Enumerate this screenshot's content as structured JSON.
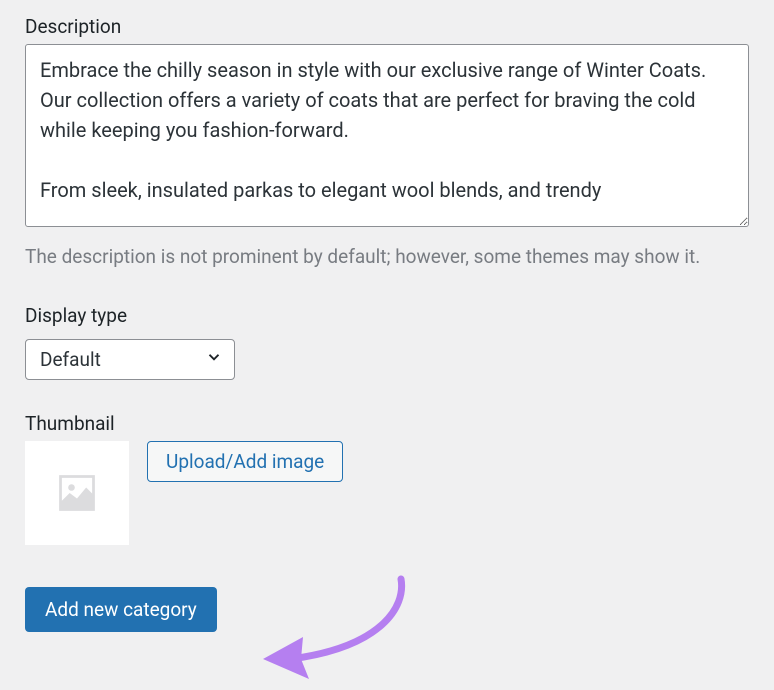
{
  "description": {
    "label": "Description",
    "value": "Embrace the chilly season in style with our exclusive range of Winter Coats. Our collection offers a variety of coats that are perfect for braving the cold while keeping you fashion-forward.\n\nFrom sleek, insulated parkas to elegant wool blends, and trendy",
    "help": "The description is not prominent by default; however, some themes may show it."
  },
  "display_type": {
    "label": "Display type",
    "selected": "Default"
  },
  "thumbnail": {
    "label": "Thumbnail",
    "upload_label": "Upload/Add image"
  },
  "submit": {
    "label": "Add new category"
  },
  "colors": {
    "primary": "#2271b1",
    "arrow": "#b57ff0"
  }
}
